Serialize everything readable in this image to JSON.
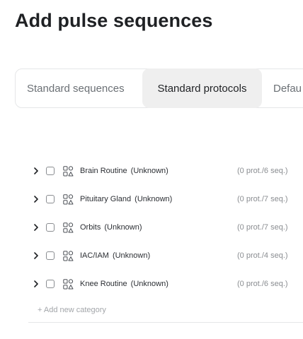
{
  "page": {
    "title": "Add pulse sequences"
  },
  "tabs": [
    {
      "label": "Standard sequences",
      "active": false
    },
    {
      "label": "Standard protocols",
      "active": true
    },
    {
      "label": "Defau",
      "active": false
    }
  ],
  "categories": [
    {
      "name": "Brain Routine",
      "status": "(Unknown)",
      "counts": "(0 prot./6 seq.)"
    },
    {
      "name": "Pituitary Gland",
      "status": "(Unknown)",
      "counts": "(0 prot./7 seq.)"
    },
    {
      "name": "Orbits",
      "status": "(Unknown)",
      "counts": "(0 prot./7 seq.)"
    },
    {
      "name": "IAC/IAM",
      "status": "(Unknown)",
      "counts": "(0 prot./4 seq.)"
    },
    {
      "name": "Knee Routine",
      "status": "(Unknown)",
      "counts": "(0 prot./6 seq.)"
    }
  ],
  "add_category_label": "+ Add new category",
  "icons": {
    "row_expand": "chevron-right-icon",
    "category": "shapes-icon"
  },
  "colors": {
    "active_tab_bg": "#efefef",
    "muted_text": "#8a8d91"
  }
}
